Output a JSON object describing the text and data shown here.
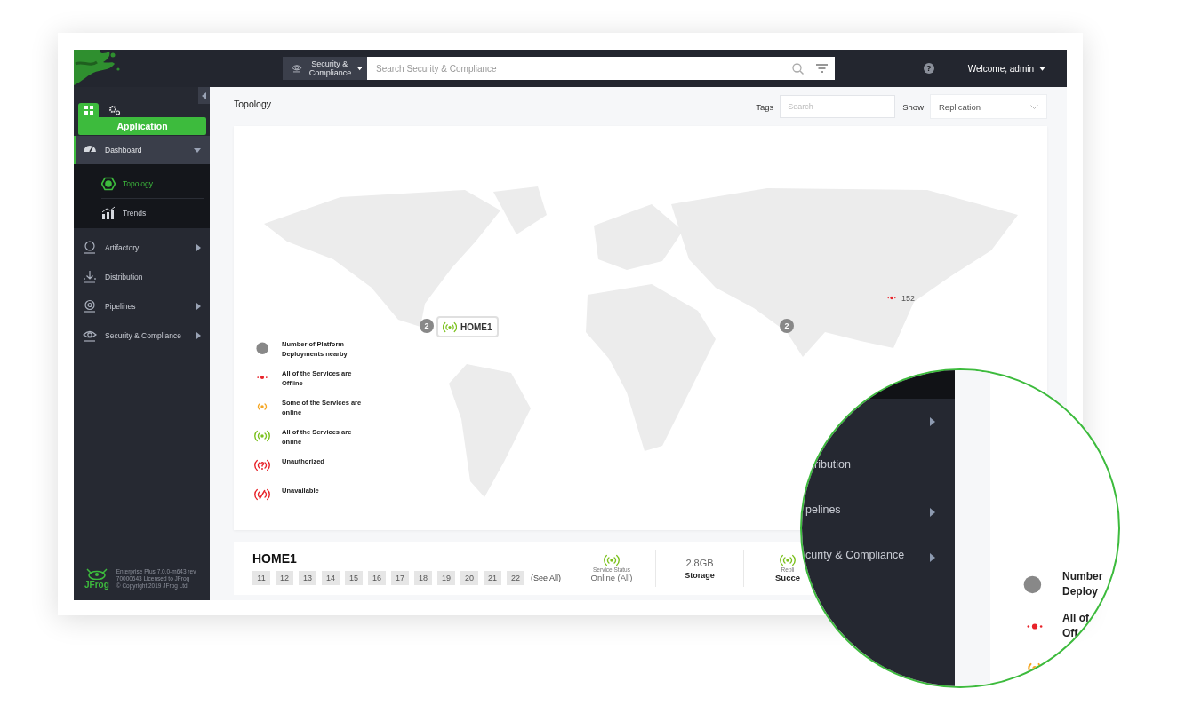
{
  "topbar": {
    "scope": "Security & Compliance",
    "search": {
      "placeholder": "Search Security & Compliance"
    },
    "help": "?",
    "user": "Welcome, admin"
  },
  "sidebar": {
    "tabs": [
      {
        "kind": "apps",
        "selected": true
      },
      {
        "kind": "settings",
        "selected": false
      }
    ],
    "section": "Application",
    "items": [
      {
        "label": "Dashboard",
        "selected": true,
        "expanded": true,
        "has_submenu": true,
        "children": [
          {
            "label": "Topology",
            "selected": true
          },
          {
            "label": "Trends",
            "selected": false
          }
        ]
      },
      {
        "label": "Artifactory",
        "selected": false,
        "expanded": false,
        "has_submenu": true
      },
      {
        "label": "Distribution",
        "selected": false,
        "expanded": false,
        "has_submenu": false
      },
      {
        "label": "Pipelines",
        "selected": false,
        "expanded": false,
        "has_submenu": true
      },
      {
        "label": "Security & Compliance",
        "selected": false,
        "expanded": false,
        "has_submenu": true
      }
    ],
    "footer": {
      "logo": "JFrog",
      "lines": [
        "Enterprise Plus 7.0.0-m643 rev",
        "70000643 Licensed to JFrog",
        "© Copyright 2019 JFrog Ltd"
      ]
    }
  },
  "page": {
    "title": "Topology",
    "tags_label": "Tags",
    "tags_placeholder": "Search",
    "show_label": "Show",
    "show_value": "Replication"
  },
  "map": {
    "markers": [
      {
        "kind": "cluster",
        "count": "2"
      },
      {
        "kind": "site",
        "label": "HOME1"
      },
      {
        "kind": "cluster",
        "count": "2"
      },
      {
        "kind": "offline",
        "label": "152"
      }
    ],
    "legend": [
      {
        "kind": "cluster",
        "text": "Number of Platform Deployments nearby"
      },
      {
        "kind": "offline",
        "text": "All of the Services are Offline"
      },
      {
        "kind": "partial",
        "text": "Some of the Services are online"
      },
      {
        "kind": "online",
        "text": "All of the Services are online"
      },
      {
        "kind": "unauthorized",
        "text": "Unauthorized"
      },
      {
        "kind": "unavailable",
        "text": "Unavailable"
      }
    ]
  },
  "site_panel": {
    "name": "HOME1",
    "nodes": [
      "11",
      "12",
      "13",
      "14",
      "15",
      "16",
      "17",
      "18",
      "19",
      "20",
      "21",
      "22"
    ],
    "see_all": "(See All)",
    "stats": [
      {
        "kind": "status",
        "label": "Service Status",
        "value": "Online (All)"
      },
      {
        "kind": "storage",
        "value": "2.8GB",
        "label": "Storage"
      },
      {
        "kind": "replication",
        "label": "Repli",
        "value": "Succe"
      }
    ]
  },
  "magnifier": {
    "menu_rows": [
      {
        "has_submenu": true
      },
      {
        "text": "ribution",
        "has_submenu": false
      },
      {
        "text": "pelines",
        "has_submenu": true
      },
      {
        "text": "curity & Compliance",
        "has_submenu": true
      }
    ],
    "legend": [
      {
        "kind": "cluster",
        "lines": [
          "Number",
          "Deploy"
        ]
      },
      {
        "kind": "offline",
        "lines": [
          "All of",
          "Off"
        ]
      },
      {
        "kind": "partial"
      }
    ]
  }
}
